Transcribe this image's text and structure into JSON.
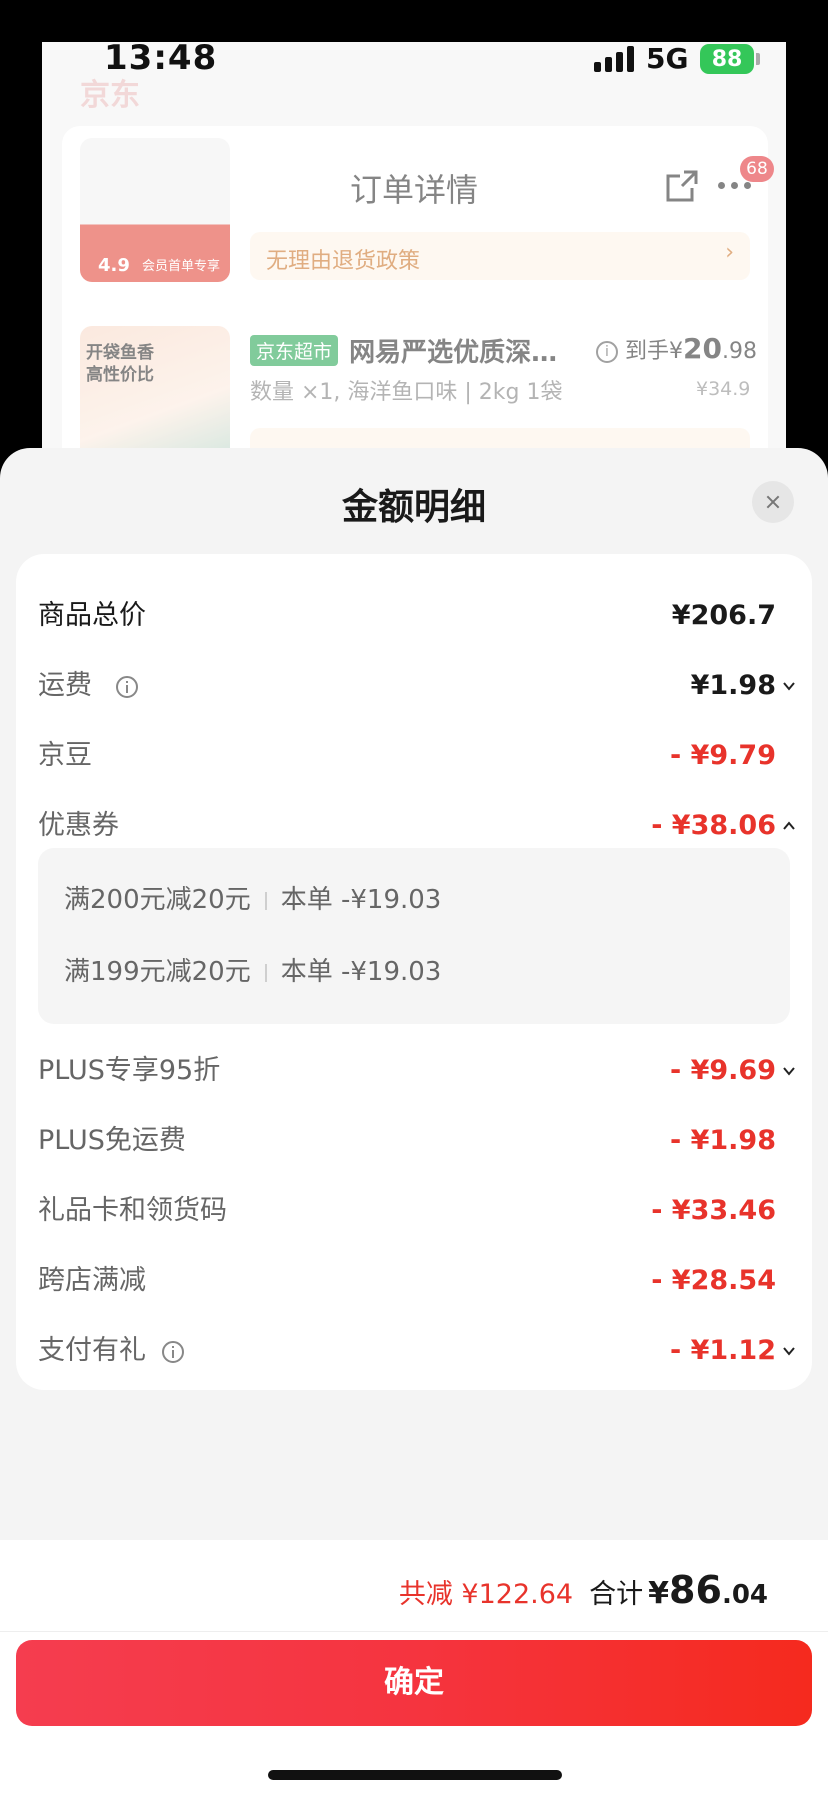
{
  "status_bar": {
    "time": "13:48",
    "network": "5G",
    "battery": "88"
  },
  "background_page": {
    "brand": "京东",
    "nav_title": "订单详情",
    "badge_count": "68",
    "return_policy_1": "无理由退货政策",
    "product_2": {
      "store_tag": "京东超市",
      "name": "网易严选优质深…",
      "price_prefix": "到手",
      "price_currency": "¥",
      "price_main": "20",
      "price_decimal": ".98",
      "spec": "数量 ×1, 海洋鱼口味 | 2kg 1袋",
      "original_price": "¥34.9",
      "image_text_line1": "开袋鱼香",
      "image_text_line2": "高性价比"
    },
    "product_1_image": {
      "price": "4.9",
      "tag": "会员首单专享"
    }
  },
  "sheet": {
    "title": "金额明细",
    "rows": [
      {
        "label": "商品总价",
        "value": "¥206.7"
      },
      {
        "label": "运费",
        "value": "¥1.98"
      },
      {
        "label": "京豆",
        "value": "- ¥9.79"
      },
      {
        "label": "优惠券",
        "value": "- ¥38.06"
      },
      {
        "label": "PLUS专享95折",
        "value": "- ¥9.69"
      },
      {
        "label": "PLUS免运费",
        "value": "- ¥1.98"
      },
      {
        "label": "礼品卡和领货码",
        "value": "- ¥33.46"
      },
      {
        "label": "跨店满减",
        "value": "- ¥28.54"
      },
      {
        "label": "支付有礼",
        "value": "- ¥1.12"
      }
    ],
    "coupons": [
      {
        "name": "满200元减20元",
        "detail": "本单 -¥19.03"
      },
      {
        "name": "满199元减20元",
        "detail": "本单 -¥19.03"
      }
    ]
  },
  "footer": {
    "total_reduce": "共减 ¥122.64",
    "total_label": "合计",
    "total_currency": "¥",
    "total_int": "86",
    "total_dec": ".04",
    "confirm_label": "确定"
  },
  "colors": {
    "accent_red": "#e8332b",
    "button_start": "#f53d4f",
    "button_end": "#f52a1e",
    "jd_green": "#1aa14a"
  }
}
